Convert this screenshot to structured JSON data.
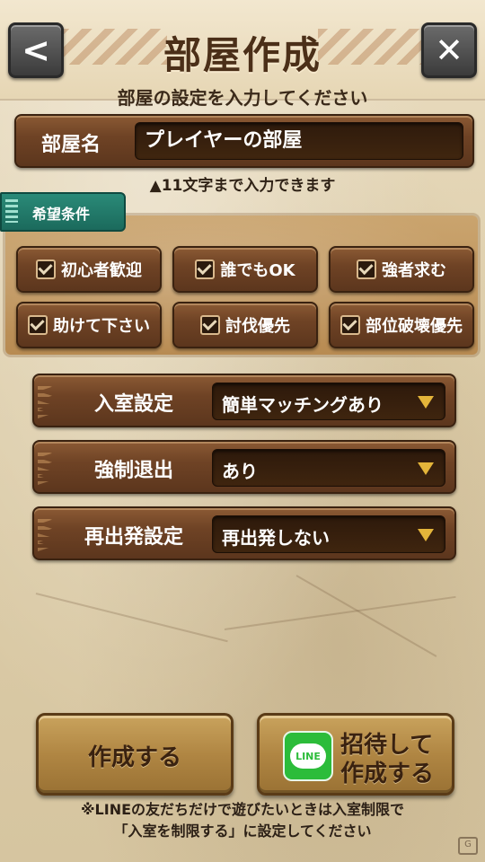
{
  "header": {
    "title": "部屋作成",
    "back_icon": "<",
    "close_icon": "✕"
  },
  "subtitle": "部屋の設定を入力してください",
  "room_name": {
    "label": "部屋名",
    "value": "プレイヤーの部屋",
    "hint": "▲11文字まで入力できます"
  },
  "conditions": {
    "tag_label": "希望条件",
    "items": [
      {
        "label": "初心者歓迎",
        "checked": true
      },
      {
        "label": "誰でもOK",
        "checked": true
      },
      {
        "label": "強者求む",
        "checked": true
      },
      {
        "label": "助けて下さい",
        "checked": true
      },
      {
        "label": "討伐優先",
        "checked": true
      },
      {
        "label": "部位破壊優先",
        "checked": true
      }
    ]
  },
  "settings": [
    {
      "label": "入室設定",
      "value": "簡単マッチングあり"
    },
    {
      "label": "強制退出",
      "value": "あり"
    },
    {
      "label": "再出発設定",
      "value": "再出発しない"
    }
  ],
  "actions": {
    "create_label": "作成する",
    "invite_line1": "招待して",
    "invite_line2": "作成する",
    "line_icon_text": "LINE"
  },
  "footer": {
    "line1": "※LINEの友だちだけで遊びたいときは入室制限で",
    "line2": "「入室を制限する」に設定してください"
  },
  "colors": {
    "accent_teal": "#1b6a5c",
    "line_green": "#2cbc3a",
    "dropdown_arrow": "#e4b53a"
  }
}
